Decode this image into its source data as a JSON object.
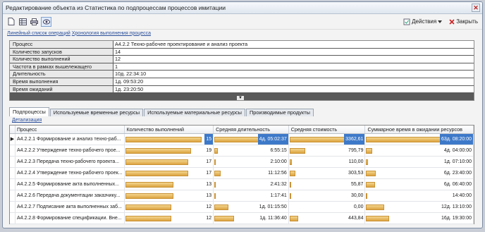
{
  "window": {
    "title": "Редактирование объекта  из Статистика по подпроцессам процессов имитации",
    "close_glyph": "✕"
  },
  "toolbar": {
    "actions_label": "Действия",
    "close_label": "Закрыть"
  },
  "links": [
    "Линейный список операций",
    "Хронология выполнения процесса"
  ],
  "properties": [
    {
      "label": "Процесс",
      "value": "А4.2.2 Техно-рабочее проектирование и анализ проекта"
    },
    {
      "label": "Количество запусков",
      "value": "14"
    },
    {
      "label": "Количество выполнений",
      "value": "12"
    },
    {
      "label": "Частота в рамках вышележащего",
      "value": "1"
    },
    {
      "label": "Длительность",
      "value": "10д. 22:34:10"
    },
    {
      "label": "Время выполнения",
      "value": "1д. 09:53:20"
    },
    {
      "label": "Время ожиданий",
      "value": "1д. 23:20:50"
    }
  ],
  "tabs": [
    "Подпроцессы",
    "Используемые временные ресурсы",
    "Используемые материальные ресурсы",
    "Производимые продукты"
  ],
  "detail_link": "Детализация",
  "grid": {
    "headers": [
      "Процесс",
      "Количество выполнений",
      "Средняя длительность",
      "Средняя стоимость",
      "Суммарное время в ожидании ресурсов"
    ],
    "row_marker": "▶",
    "rows": [
      {
        "process": "А4.2.2.1 Формирование и анализ техно-раб...",
        "count": "15",
        "count_frac": 1.0,
        "avg_dur": "4д. 05:02:37",
        "dur_frac": 1.0,
        "avg_cost": "3362,61",
        "cost_frac": 1.0,
        "wait": "63д. 08:20:00",
        "wait_frac": 1.0,
        "selected": true
      },
      {
        "process": "А4.2.2.2 Утверждение техно-рабочего прое...",
        "count": "19",
        "count_frac": 0.86,
        "avg_dur": "6:55:15",
        "dur_frac": 0.06,
        "avg_cost": "795,79",
        "cost_frac": 0.24,
        "wait": "4д. 04:00:00",
        "wait_frac": 0.07,
        "selected": false
      },
      {
        "process": "А4.2.2.3 Передача техно-рабочего проекта...",
        "count": "17",
        "count_frac": 0.82,
        "avg_dur": "2:10:00",
        "dur_frac": 0.02,
        "avg_cost": "110,00",
        "cost_frac": 0.03,
        "wait": "1д. 07:10:00",
        "wait_frac": 0.02,
        "selected": false
      },
      {
        "process": "А4.2.2.4 Утверждение техно-рабочего проек...",
        "count": "17",
        "count_frac": 0.82,
        "avg_dur": "11:12:56",
        "dur_frac": 0.11,
        "avg_cost": "303,53",
        "cost_frac": 0.09,
        "wait": "6д. 23:40:00",
        "wait_frac": 0.11,
        "selected": false
      },
      {
        "process": "А4.2.2.5 Формирование акта выполненных...",
        "count": "13",
        "count_frac": 0.63,
        "avg_dur": "2:41:32",
        "dur_frac": 0.03,
        "avg_cost": "55,87",
        "cost_frac": 0.02,
        "wait": "6д. 06:40:00",
        "wait_frac": 0.1,
        "selected": false
      },
      {
        "process": "А4.2.2.6 Передача документации заказчику...",
        "count": "13",
        "count_frac": 0.63,
        "avg_dur": "1:17:41",
        "dur_frac": 0.01,
        "avg_cost": "30,00",
        "cost_frac": 0.01,
        "wait": "14:40:00",
        "wait_frac": 0.01,
        "selected": false
      },
      {
        "process": "А4.2.2.7 Подписание акта выполненных заб...",
        "count": "12",
        "count_frac": 0.6,
        "avg_dur": "1д. 01:15:50",
        "dur_frac": 0.25,
        "avg_cost": "0,00",
        "cost_frac": 0.0,
        "wait": "12д. 13:10:00",
        "wait_frac": 0.2,
        "selected": false
      },
      {
        "process": "А4.2.2.8 Формирование спецификации. Вне...",
        "count": "12",
        "count_frac": 0.6,
        "avg_dur": "1д. 11:36:40",
        "dur_frac": 0.35,
        "avg_cost": "443,84",
        "cost_frac": 0.13,
        "wait": "16д. 19:30:00",
        "wait_frac": 0.26,
        "selected": false
      }
    ]
  },
  "colors": {
    "bar": "#dca441",
    "highlight": "#3d79c9"
  }
}
